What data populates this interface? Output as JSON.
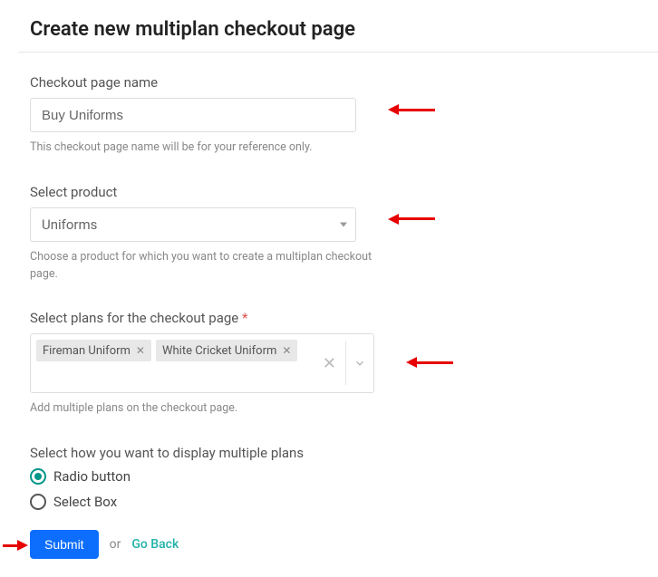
{
  "title": "Create new multiplan checkout page",
  "fields": {
    "name": {
      "label": "Checkout page name",
      "value": "Buy Uniforms",
      "help": "This checkout page name will be for your reference only."
    },
    "product": {
      "label": "Select product",
      "value": "Uniforms",
      "help": "Choose a product for which you want to create a multiplan checkout page."
    },
    "plans": {
      "label": "Select plans for the checkout page",
      "required": "*",
      "tags": [
        "Fireman Uniform",
        "White Cricket Uniform"
      ],
      "help": "Add multiple plans on the checkout page."
    },
    "display": {
      "label": "Select how you want to display multiple plans",
      "options": [
        {
          "label": "Radio button",
          "checked": true
        },
        {
          "label": "Select Box",
          "checked": false
        }
      ]
    }
  },
  "actions": {
    "submit": "Submit",
    "or": "or",
    "goback": "Go Back"
  }
}
